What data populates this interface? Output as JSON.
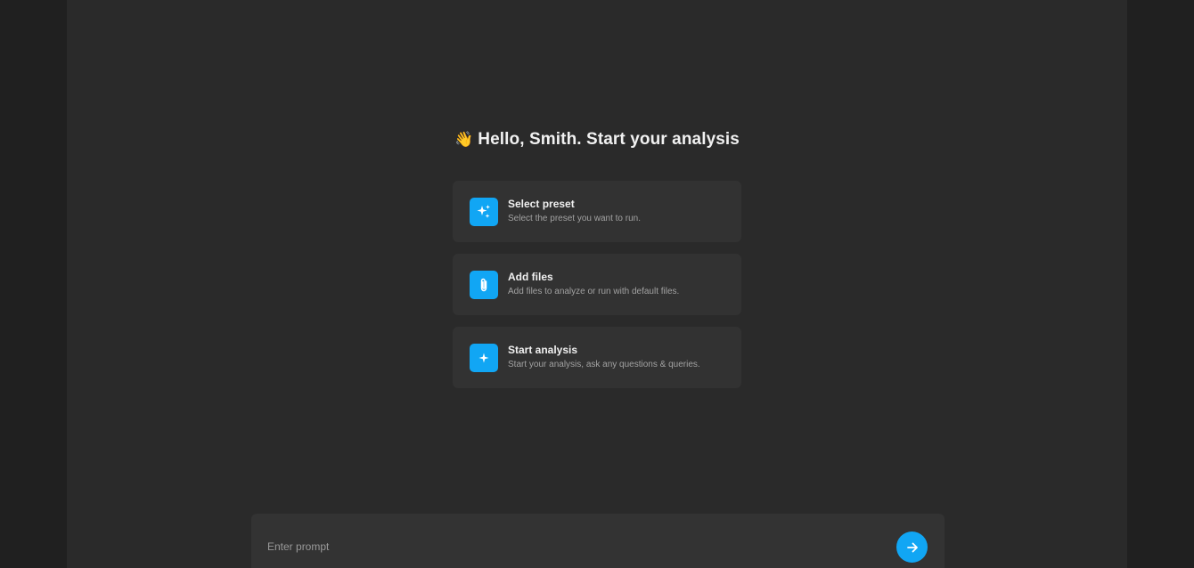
{
  "greeting": {
    "emoji": "👋",
    "text": "Hello, Smith. Start your analysis"
  },
  "cards": [
    {
      "title": "Select preset",
      "description": "Select the preset you want to run.",
      "icon": "sparkles-icon"
    },
    {
      "title": "Add files",
      "description": "Add files to analyze or run with default files.",
      "icon": "paperclip-icon"
    },
    {
      "title": "Start analysis",
      "description": "Start your analysis, ask any questions & queries.",
      "icon": "sparkle-icon"
    }
  ],
  "prompt": {
    "placeholder": "Enter prompt",
    "value": "",
    "send_icon": "arrow-right-icon"
  },
  "colors": {
    "accent": "#11a6f4",
    "background": "#2a2a2a",
    "card": "#323232"
  }
}
